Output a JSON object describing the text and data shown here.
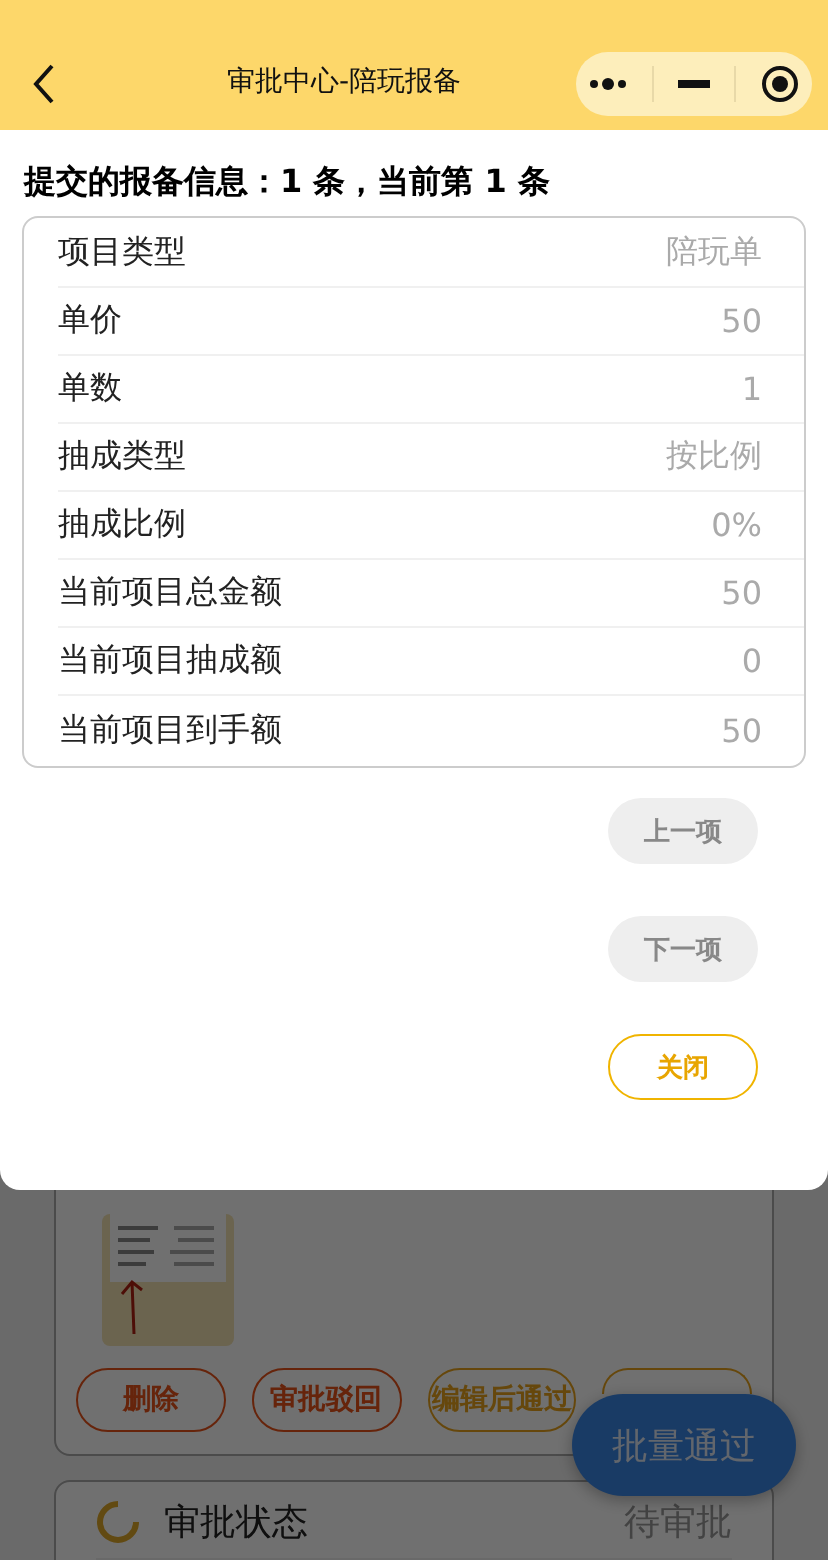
{
  "nav": {
    "title": "审批中心-陪玩报备"
  },
  "modal": {
    "heading": "提交的报备信息：1 条，当前第 1 条",
    "rows": [
      {
        "label": "项目类型",
        "value": "陪玩单"
      },
      {
        "label": "单价",
        "value": "50"
      },
      {
        "label": "单数",
        "value": "1"
      },
      {
        "label": "抽成类型",
        "value": "按比例"
      },
      {
        "label": "抽成比例",
        "value": "0%"
      },
      {
        "label": "当前项目总金额",
        "value": "50"
      },
      {
        "label": "当前项目抽成额",
        "value": "0"
      },
      {
        "label": "当前项目到手额",
        "value": "50"
      }
    ],
    "buttons": [
      {
        "label": "上一项",
        "kind": "secondary"
      },
      {
        "label": "下一项",
        "kind": "secondary"
      },
      {
        "label": "关闭",
        "kind": "outline"
      }
    ]
  },
  "background": {
    "actions": [
      {
        "label": "删除",
        "kind": "danger"
      },
      {
        "label": "审批驳回",
        "kind": "danger"
      },
      {
        "label": "编辑后通过",
        "kind": "warning"
      },
      {
        "kind": "warning"
      }
    ],
    "status": {
      "label": "审批状态",
      "value": "待审批"
    },
    "batch_button": "批量通过"
  }
}
